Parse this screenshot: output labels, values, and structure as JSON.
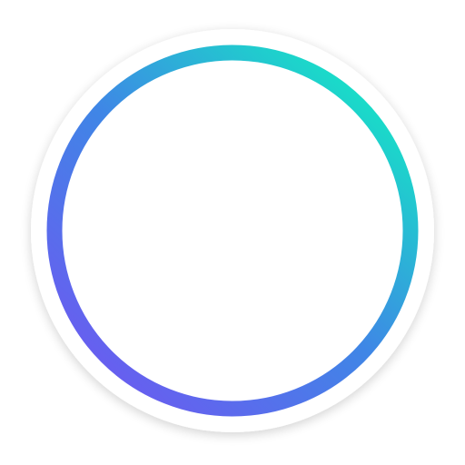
{
  "icon": {
    "name": "gradient-ring-app-icon",
    "colors": {
      "background": "#ffffff",
      "disc": "#ffffff",
      "ring_gradient_start": "#6a5cf0",
      "ring_gradient_mid": "#3f86e6",
      "ring_gradient_end": "#16e3c6"
    }
  }
}
